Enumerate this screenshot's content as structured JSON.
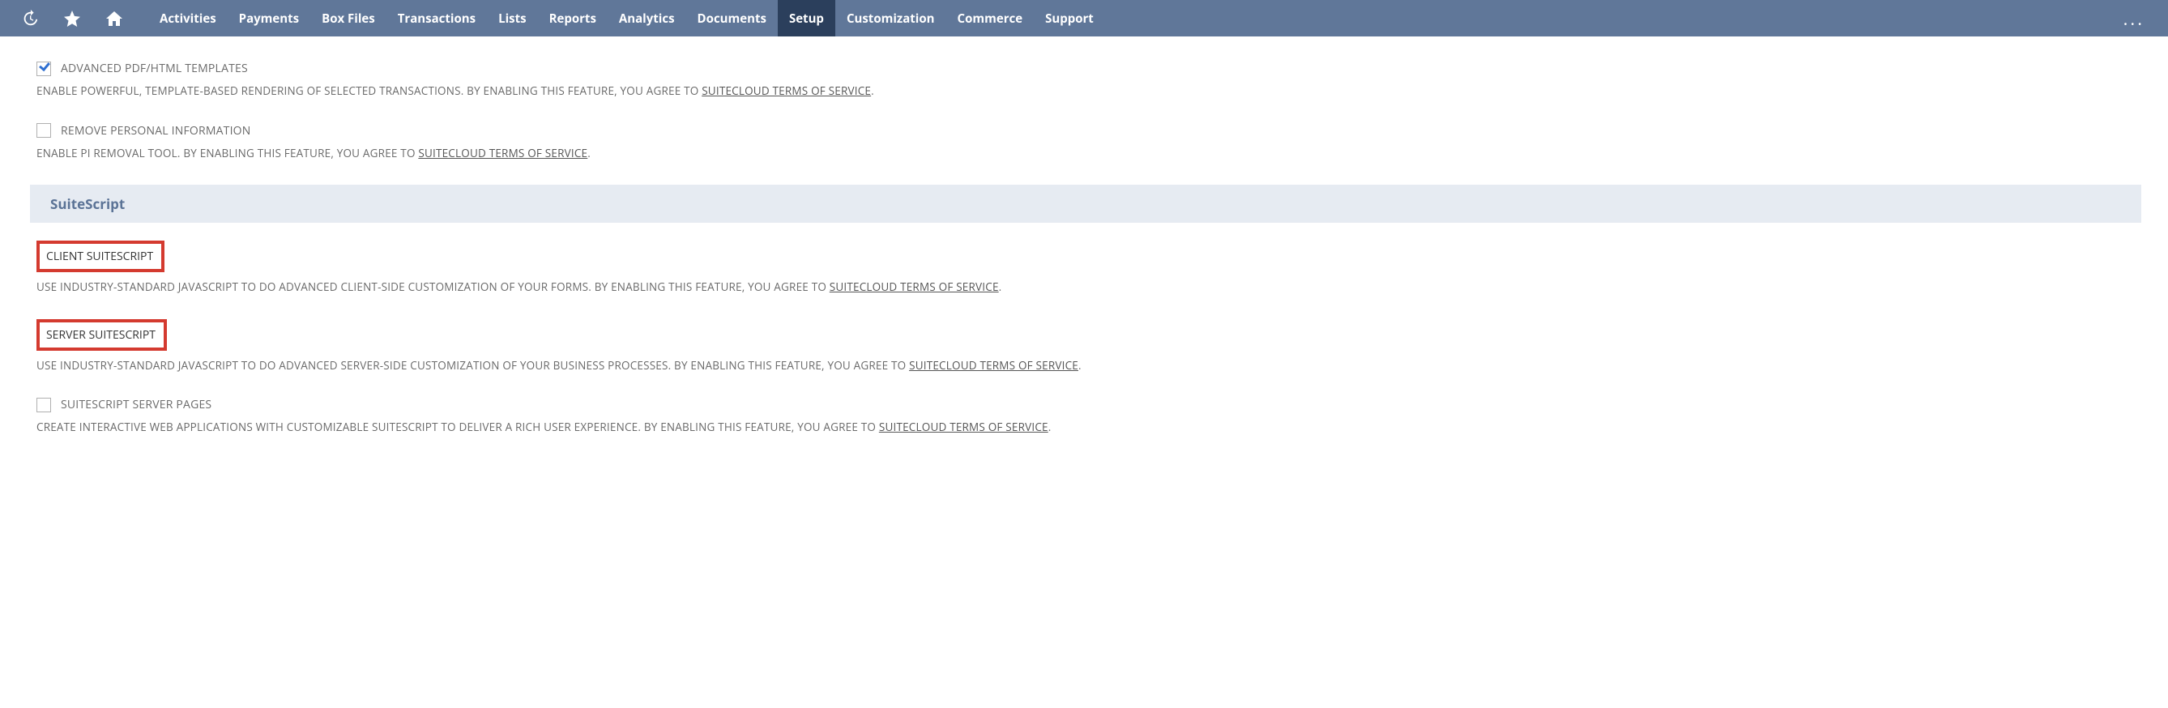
{
  "nav": {
    "items": [
      "Activities",
      "Payments",
      "Box Files",
      "Transactions",
      "Lists",
      "Reports",
      "Analytics",
      "Documents",
      "Setup",
      "Customization",
      "Commerce",
      "Support"
    ],
    "active": "Setup",
    "more": "..."
  },
  "section1": {
    "features": [
      {
        "label": "ADVANCED PDF/HTML TEMPLATES",
        "checked": true,
        "highlight": false,
        "desc_pre": "ENABLE POWERFUL, TEMPLATE-BASED RENDERING OF SELECTED TRANSACTIONS. BY ENABLING THIS FEATURE, YOU AGREE TO ",
        "link": "SUITECLOUD TERMS OF SERVICE",
        "desc_post": "."
      },
      {
        "label": "REMOVE PERSONAL INFORMATION",
        "checked": false,
        "highlight": false,
        "desc_pre": "ENABLE PI REMOVAL TOOL. BY ENABLING THIS FEATURE, YOU AGREE TO ",
        "link": "SUITECLOUD TERMS OF SERVICE",
        "desc_post": "."
      }
    ]
  },
  "section2": {
    "title": "SuiteScript",
    "features": [
      {
        "label": "CLIENT SUITESCRIPT",
        "checked": true,
        "highlight": true,
        "desc_pre": "USE INDUSTRY-STANDARD JAVASCRIPT TO DO ADVANCED CLIENT-SIDE CUSTOMIZATION OF YOUR FORMS. BY ENABLING THIS FEATURE, YOU AGREE TO ",
        "link": "SUITECLOUD TERMS OF SERVICE",
        "desc_post": "."
      },
      {
        "label": "SERVER SUITESCRIPT",
        "checked": true,
        "highlight": true,
        "desc_pre": "USE INDUSTRY-STANDARD JAVASCRIPT TO DO ADVANCED SERVER-SIDE CUSTOMIZATION OF YOUR BUSINESS PROCESSES. BY ENABLING THIS FEATURE, YOU AGREE TO ",
        "link": "SUITECLOUD TERMS OF SERVICE",
        "desc_post": "."
      },
      {
        "label": "SUITESCRIPT SERVER PAGES",
        "checked": false,
        "highlight": false,
        "desc_pre": "CREATE INTERACTIVE WEB APPLICATIONS WITH CUSTOMIZABLE SUITESCRIPT TO DELIVER A RICH USER EXPERIENCE. BY ENABLING THIS FEATURE, YOU AGREE TO ",
        "link": "SUITECLOUD TERMS OF SERVICE",
        "desc_post": "."
      }
    ]
  }
}
